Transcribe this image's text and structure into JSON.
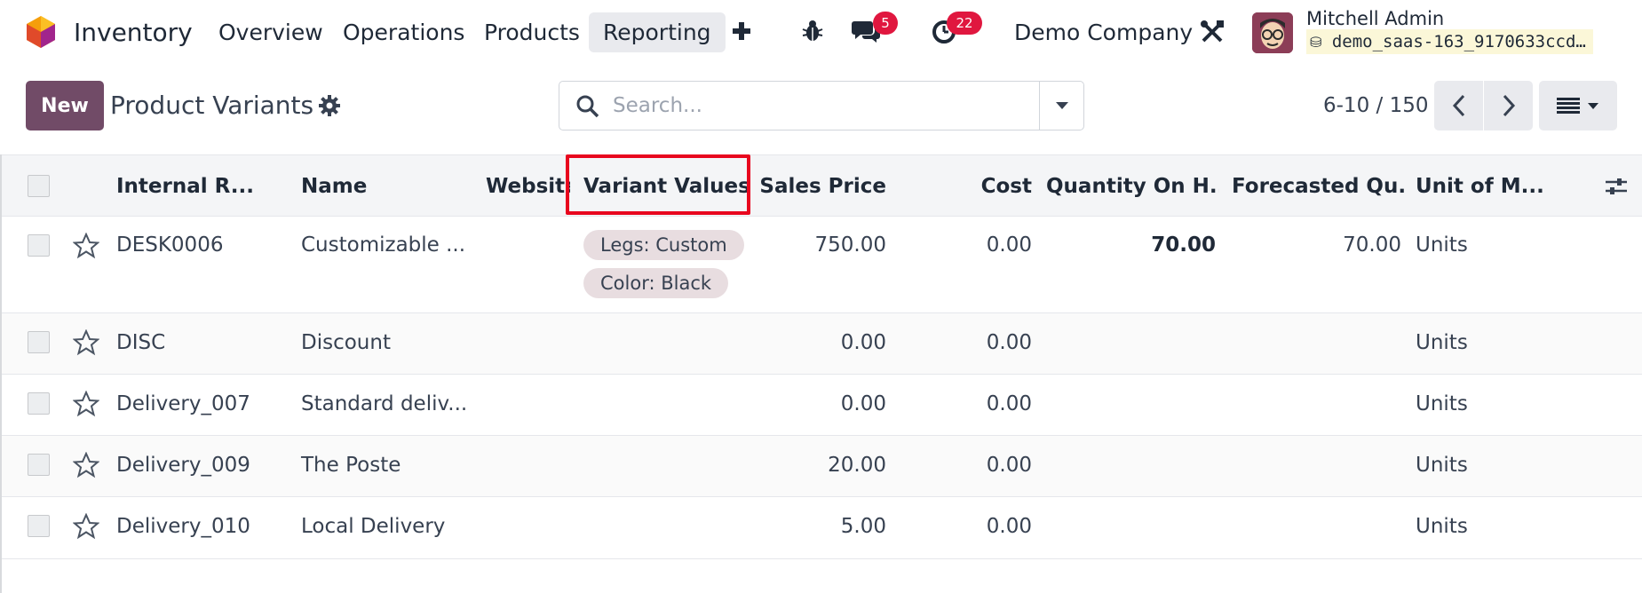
{
  "navbar": {
    "app_title": "Inventory",
    "menu": [
      {
        "label": "Overview"
      },
      {
        "label": "Operations"
      },
      {
        "label": "Products"
      },
      {
        "label": "Reporting",
        "active": true
      }
    ],
    "add_icon": "plus-icon",
    "debug_icon": "bug-icon",
    "messages_icon": "chat-icon",
    "messages_count": "5",
    "activities_icon": "clock-icon",
    "activities_count": "22",
    "company": "Demo Company",
    "settings_icon": "tools-icon",
    "user_name": "Mitchell Admin",
    "database": "demo_saas-163_9170633ccd…"
  },
  "control_panel": {
    "new_label": "New",
    "title": "Product Variants",
    "search_placeholder": "Search...",
    "pager_value": "6-10 / 150"
  },
  "table": {
    "columns": [
      {
        "key": "internal_ref",
        "label": "Internal R..."
      },
      {
        "key": "name",
        "label": "Name"
      },
      {
        "key": "website",
        "label": "Website"
      },
      {
        "key": "variant_values",
        "label": "Variant Values"
      },
      {
        "key": "sales_price",
        "label": "Sales Price"
      },
      {
        "key": "cost",
        "label": "Cost"
      },
      {
        "key": "qty_on_hand",
        "label": "Quantity On H..."
      },
      {
        "key": "forecasted",
        "label": "Forecasted Qu..."
      },
      {
        "key": "uom",
        "label": "Unit of M..."
      }
    ],
    "rows": [
      {
        "internal_ref": "DESK0006",
        "name": "Customizable ...",
        "variant_values": [
          "Legs: Custom",
          "Color: Black"
        ],
        "sales_price": "750.00",
        "cost": "0.00",
        "qty_on_hand": "70.00",
        "forecasted": "70.00",
        "uom": "Units"
      },
      {
        "internal_ref": "DISC",
        "name": "Discount",
        "variant_values": [],
        "sales_price": "0.00",
        "cost": "0.00",
        "qty_on_hand": "",
        "forecasted": "",
        "uom": "Units"
      },
      {
        "internal_ref": "Delivery_007",
        "name": "Standard deliv...",
        "variant_values": [],
        "sales_price": "0.00",
        "cost": "0.00",
        "qty_on_hand": "",
        "forecasted": "",
        "uom": "Units"
      },
      {
        "internal_ref": "Delivery_009",
        "name": "The Poste",
        "variant_values": [],
        "sales_price": "20.00",
        "cost": "0.00",
        "qty_on_hand": "",
        "forecasted": "",
        "uom": "Units"
      },
      {
        "internal_ref": "Delivery_010",
        "name": "Local Delivery",
        "variant_values": [],
        "sales_price": "5.00",
        "cost": "0.00",
        "qty_on_hand": "",
        "forecasted": "",
        "uom": "Units"
      }
    ]
  },
  "colors": {
    "brand": "#714b67",
    "badge": "#e0173f",
    "highlight": "#e8061e",
    "tag_bg": "#e8dde0"
  }
}
